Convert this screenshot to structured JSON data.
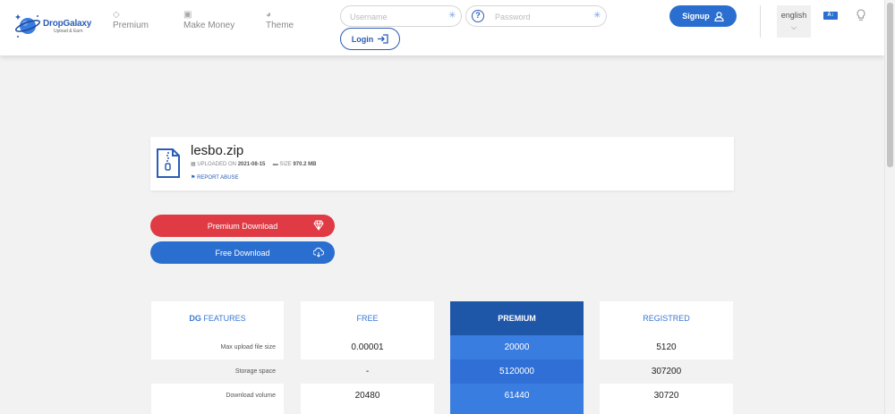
{
  "logo": {
    "name": "DropGalaxy",
    "tagline": "Upload & Earn"
  },
  "nav": [
    {
      "label": "Premium",
      "icon": "diamond-icon"
    },
    {
      "label": "Make Money",
      "icon": "wallet-icon"
    },
    {
      "label": "Theme",
      "icon": "palette-icon"
    }
  ],
  "auth": {
    "username_placeholder": "Username",
    "password_placeholder": "Password",
    "login_label": "Login",
    "signup_label": "Signup"
  },
  "language": {
    "value": "english",
    "badge": "A"
  },
  "file": {
    "name": "lesbo.zip",
    "uploaded_label": "UPLOADED ON",
    "uploaded_date": "2021-08-15",
    "size_label": "SIZE",
    "size_value": "970.2 MB",
    "report_label": "REPORT ABUSE"
  },
  "downloads": {
    "premium_label": "Premium Download",
    "free_label": "Free Download"
  },
  "features": {
    "header_bold": "DG",
    "header_rest": " FEATURES",
    "rows": [
      "Max upload file size",
      "Storage space",
      "Download volume"
    ],
    "plans": [
      {
        "name": "FREE",
        "values": [
          "0.00001",
          "-",
          "20480"
        ]
      },
      {
        "name": "PREMIUM",
        "values": [
          "20000",
          "5120000",
          "61440"
        ]
      },
      {
        "name": "REGISTRED",
        "values": [
          "5120",
          "307200",
          "30720"
        ]
      }
    ]
  },
  "colors": {
    "brand_blue": "#2a6fcf",
    "premium_red": "#e03a44",
    "premium_column": "#3a7de0"
  }
}
